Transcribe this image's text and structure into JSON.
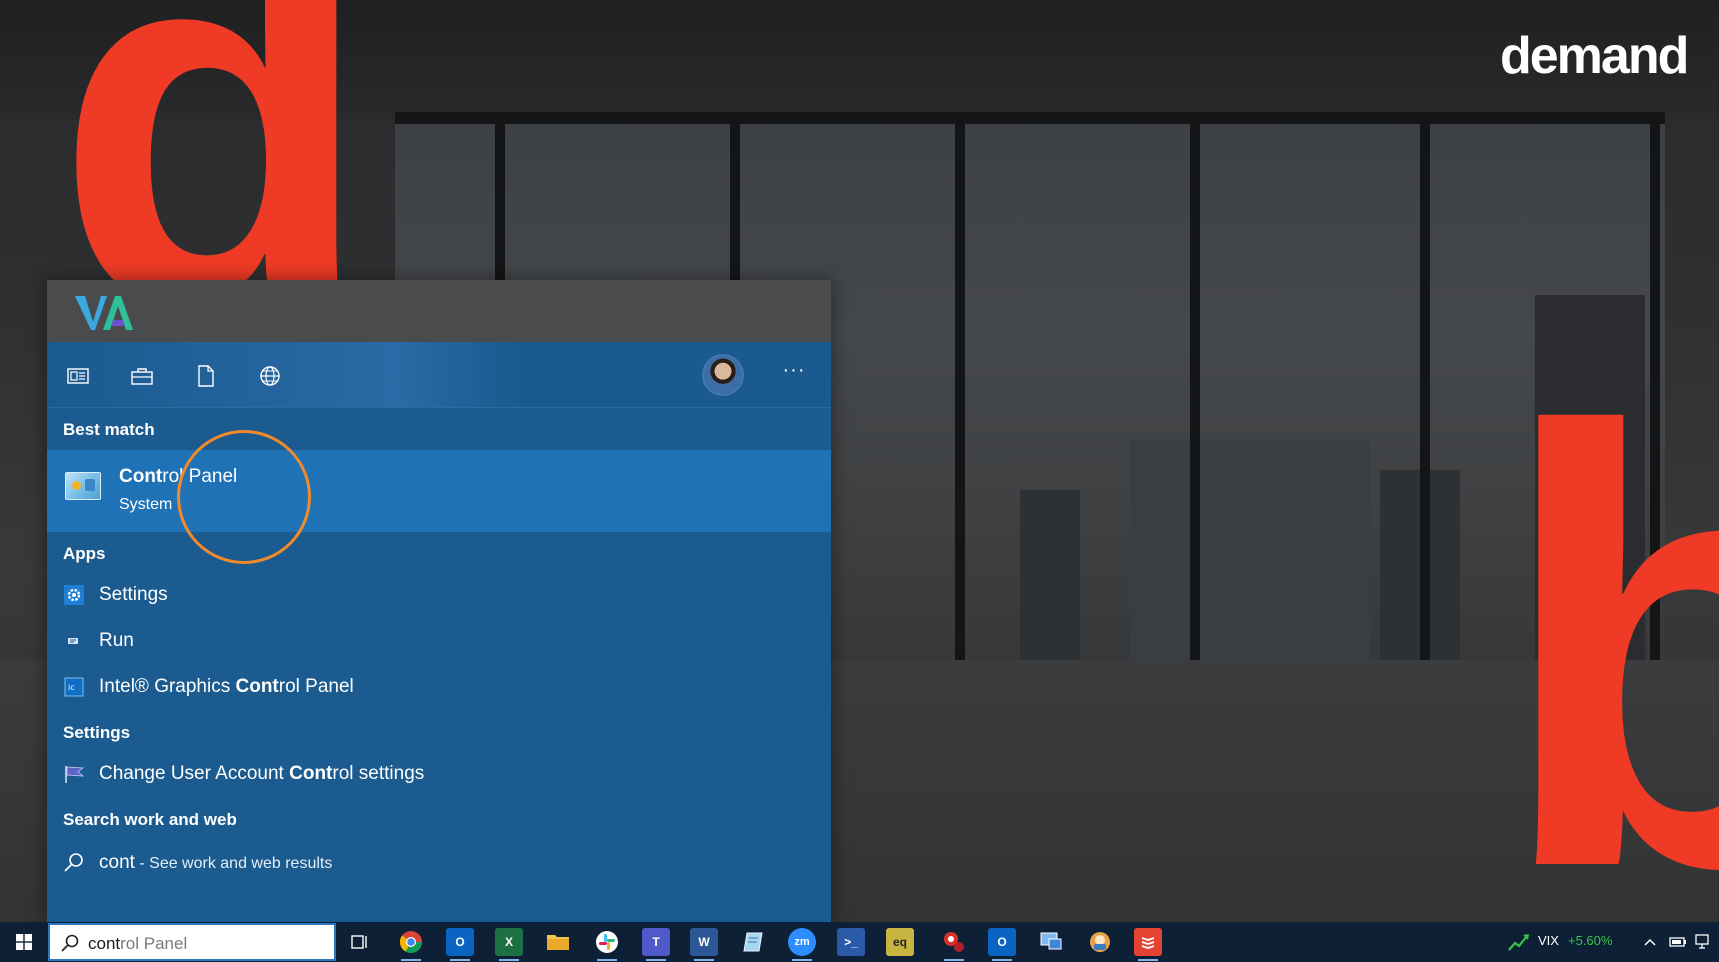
{
  "wallpaper": {
    "brand_letter_left": "d",
    "brand_letter_right": "b",
    "wordmark": "demand"
  },
  "search_panel": {
    "header_logo": "VA",
    "tabs": [
      {
        "name": "all-icon"
      },
      {
        "name": "apps-icon"
      },
      {
        "name": "documents-icon"
      },
      {
        "name": "web-icon"
      }
    ],
    "more_label": "···",
    "best_match": {
      "heading": "Best match",
      "title_bold": "Co",
      "title_bold2": "nt",
      "title_rest": "rol Panel",
      "subtitle": "System"
    },
    "apps": {
      "heading": "Apps",
      "items": [
        {
          "pre": "Settings",
          "bold": "",
          "post": ""
        },
        {
          "pre": "Run",
          "bold": "",
          "post": ""
        },
        {
          "pre": "Intel® Graphics ",
          "bold": "Cont",
          "post": "rol Panel"
        }
      ]
    },
    "settings": {
      "heading": "Settings",
      "items": [
        {
          "pre": "Change User Account ",
          "bold": "Cont",
          "post": "rol settings"
        }
      ]
    },
    "web": {
      "heading": "Search work and web",
      "query": "cont",
      "hint": " - See work and web results"
    }
  },
  "taskbar": {
    "search_typed": "cont",
    "search_rest": "rol Panel",
    "pinned": [
      {
        "name": "task-view-icon",
        "label": ""
      },
      {
        "name": "chrome-icon",
        "label": ""
      },
      {
        "name": "outlook-icon",
        "label": "O"
      },
      {
        "name": "excel-icon",
        "label": "X"
      },
      {
        "name": "file-explorer-icon",
        "label": ""
      },
      {
        "name": "slack-icon",
        "label": ""
      },
      {
        "name": "teams-icon",
        "label": "T"
      },
      {
        "name": "word-icon",
        "label": "W"
      },
      {
        "name": "notepad-icon",
        "label": ""
      },
      {
        "name": "zoom-icon",
        "label": "zm"
      },
      {
        "name": "powershell-icon",
        "label": ">_"
      },
      {
        "name": "app-eq-icon",
        "label": "eq"
      },
      {
        "name": "snipping-tool-icon",
        "label": ""
      },
      {
        "name": "outlook-2-icon",
        "label": "O"
      },
      {
        "name": "remote-desktop-icon",
        "label": ""
      },
      {
        "name": "game-icon",
        "label": ""
      },
      {
        "name": "todoist-icon",
        "label": ""
      }
    ],
    "ticker_symbol": "VIX",
    "ticker_change": "+5.60%"
  },
  "colors": {
    "panel_bg": "#1c5b8f",
    "selected_bg": "#2072b7",
    "accent_red": "#ef3b25",
    "ring_orange": "#f08a2b"
  }
}
